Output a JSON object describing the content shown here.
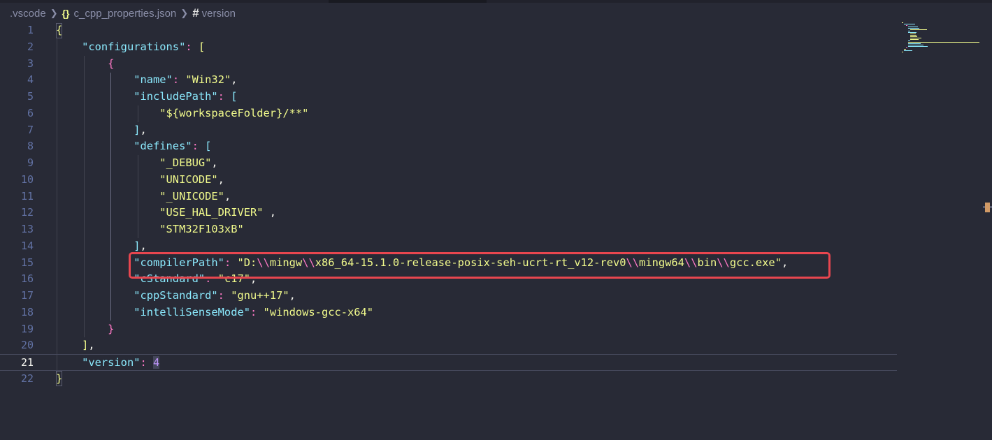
{
  "breadcrumb": {
    "folder": ".vscode",
    "file": "c_cpp_properties.json",
    "symbol": "version",
    "file_icon": "json-braces-icon",
    "symbol_icon": "hash-icon",
    "sep": "❯"
  },
  "editor": {
    "current_line": 21,
    "lines": [
      {
        "n": "1"
      },
      {
        "n": "2"
      },
      {
        "n": "3"
      },
      {
        "n": "4"
      },
      {
        "n": "5"
      },
      {
        "n": "6"
      },
      {
        "n": "7"
      },
      {
        "n": "8"
      },
      {
        "n": "9"
      },
      {
        "n": "10"
      },
      {
        "n": "11"
      },
      {
        "n": "12"
      },
      {
        "n": "13"
      },
      {
        "n": "14"
      },
      {
        "n": "15"
      },
      {
        "n": "16"
      },
      {
        "n": "17"
      },
      {
        "n": "18"
      },
      {
        "n": "19"
      },
      {
        "n": "20"
      },
      {
        "n": "21"
      },
      {
        "n": "22"
      }
    ],
    "tokens": {
      "l1_open": "{",
      "l2_key": "\"configurations\"",
      "l2_colon": ": ",
      "l2_bracket": "[",
      "l3_open": "{",
      "l4_key": "\"name\"",
      "l4_colon": ": ",
      "l4_val": "\"Win32\"",
      "l4_comma": ",",
      "l5_key": "\"includePath\"",
      "l5_colon": ": ",
      "l5_bracket": "[",
      "l6_val": "\"${workspaceFolder}/**\"",
      "l7_close": "]",
      "l7_comma": ",",
      "l8_key": "\"defines\"",
      "l8_colon": ": ",
      "l8_bracket": "[",
      "l9_val": "\"_DEBUG\"",
      "l9_comma": ",",
      "l10_val": "\"UNICODE\"",
      "l10_comma": ",",
      "l11_val": "\"_UNICODE\"",
      "l11_comma": ",",
      "l12_val": "\"USE_HAL_DRIVER\"",
      "l12_comma": " ,",
      "l13_val": "\"STM32F103xB\"",
      "l14_close": "]",
      "l14_comma": ",",
      "l15_key": "\"compilerPath\"",
      "l15_colon": ": ",
      "l15_v1": "\"D:",
      "l15_e1": "\\\\",
      "l15_v2": "mingw",
      "l15_e2": "\\\\",
      "l15_v3": "x86_64-15.1.0-release-posix-seh-ucrt-rt_v12-rev0",
      "l15_e3": "\\\\",
      "l15_v4": "mingw64",
      "l15_e4": "\\\\",
      "l15_v5": "bin",
      "l15_e5": "\\\\",
      "l15_v6": "gcc.exe\"",
      "l15_comma": ",",
      "l16_key": "\"cStandard\"",
      "l16_colon": ": ",
      "l16_val": "\"c17\"",
      "l16_comma": ",",
      "l17_key": "\"cppStandard\"",
      "l17_colon": ": ",
      "l17_val": "\"gnu++17\"",
      "l17_comma": ",",
      "l18_key": "\"intelliSenseMode\"",
      "l18_colon": ": ",
      "l18_val": "\"windows-gcc-x64\"",
      "l19_close": "}",
      "l20_close": "]",
      "l20_comma": ",",
      "l21_key": "\"version\"",
      "l21_colon": ": ",
      "l21_val": "4",
      "l22_close": "}"
    }
  },
  "colors": {
    "background": "#282a36",
    "key": "#8be9fd",
    "string": "#f1fa8c",
    "escape": "#ff79c6",
    "number": "#bd93f9",
    "highlight_border": "#e8464f"
  }
}
